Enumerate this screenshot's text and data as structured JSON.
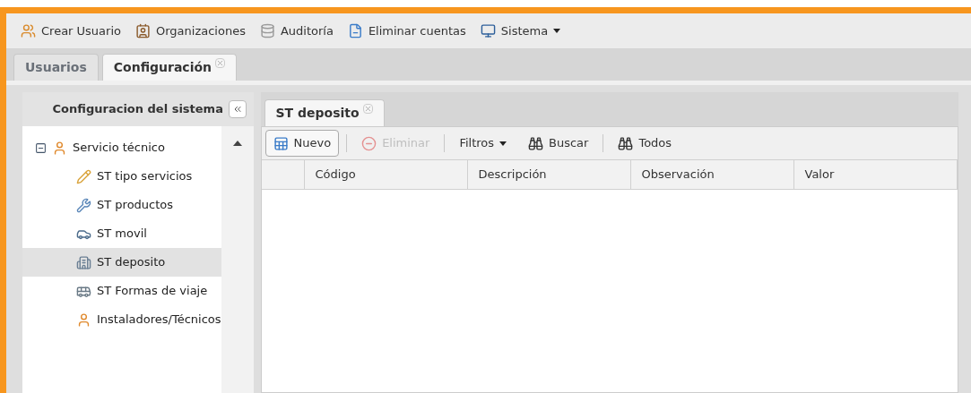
{
  "toolbar": [
    {
      "label": "Crear Usuario",
      "dropdown": false
    },
    {
      "label": "Organizaciones",
      "dropdown": false
    },
    {
      "label": "Auditoría",
      "dropdown": false
    },
    {
      "label": "Eliminar cuentas",
      "dropdown": false
    },
    {
      "label": "Sistema",
      "dropdown": true
    }
  ],
  "tabs": [
    {
      "label": "Usuarios",
      "selected": false,
      "closable": false
    },
    {
      "label": "Configuración",
      "selected": true,
      "closable": true
    }
  ],
  "sidebar": {
    "title": "Configuracion del sistema",
    "tree": [
      {
        "label": "Servicio técnico",
        "expanded": true,
        "selected": false,
        "children": [
          {
            "label": "ST tipo servicios",
            "selected": false
          },
          {
            "label": "ST productos",
            "selected": false
          },
          {
            "label": "ST movil",
            "selected": false
          },
          {
            "label": "ST deposito",
            "selected": true
          },
          {
            "label": "ST Formas de viaje",
            "selected": false
          },
          {
            "label": "Instaladores/Técnicos",
            "selected": false
          }
        ]
      }
    ]
  },
  "panel_tabs": [
    {
      "label": "ST deposito",
      "selected": true,
      "closable": true
    }
  ],
  "grid_toolbar": [
    {
      "label": "Nuevo",
      "disabled": false,
      "dropdown": false
    },
    {
      "label": "Eliminar",
      "disabled": true,
      "dropdown": false
    },
    {
      "label": "Filtros",
      "disabled": false,
      "dropdown": true
    },
    {
      "label": "Buscar",
      "disabled": false,
      "dropdown": false
    },
    {
      "label": "Todos",
      "disabled": false,
      "dropdown": false
    }
  ],
  "table": {
    "columns": [
      "Código",
      "Descripción",
      "Observación",
      "Valor"
    ]
  }
}
